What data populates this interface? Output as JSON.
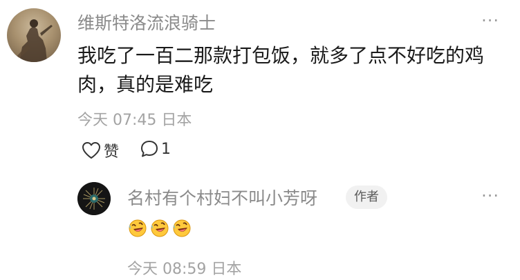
{
  "comment": {
    "username": "维斯特洛流浪骑士",
    "text": "我吃了一百二那款打包饭，就多了点不好吃的鸡肉，真的是难吃",
    "time": "今天 07:45 日本",
    "like_label": "赞",
    "reply_count": "1",
    "more_label": "···"
  },
  "reply": {
    "username": "名村有个村妇不叫小芳呀",
    "badge": "作者",
    "emoji": [
      "rolling-laugh-emoji",
      "rolling-laugh-emoji",
      "rolling-laugh-emoji"
    ],
    "time": "今天 08:59 日本",
    "more_label": "···"
  }
}
